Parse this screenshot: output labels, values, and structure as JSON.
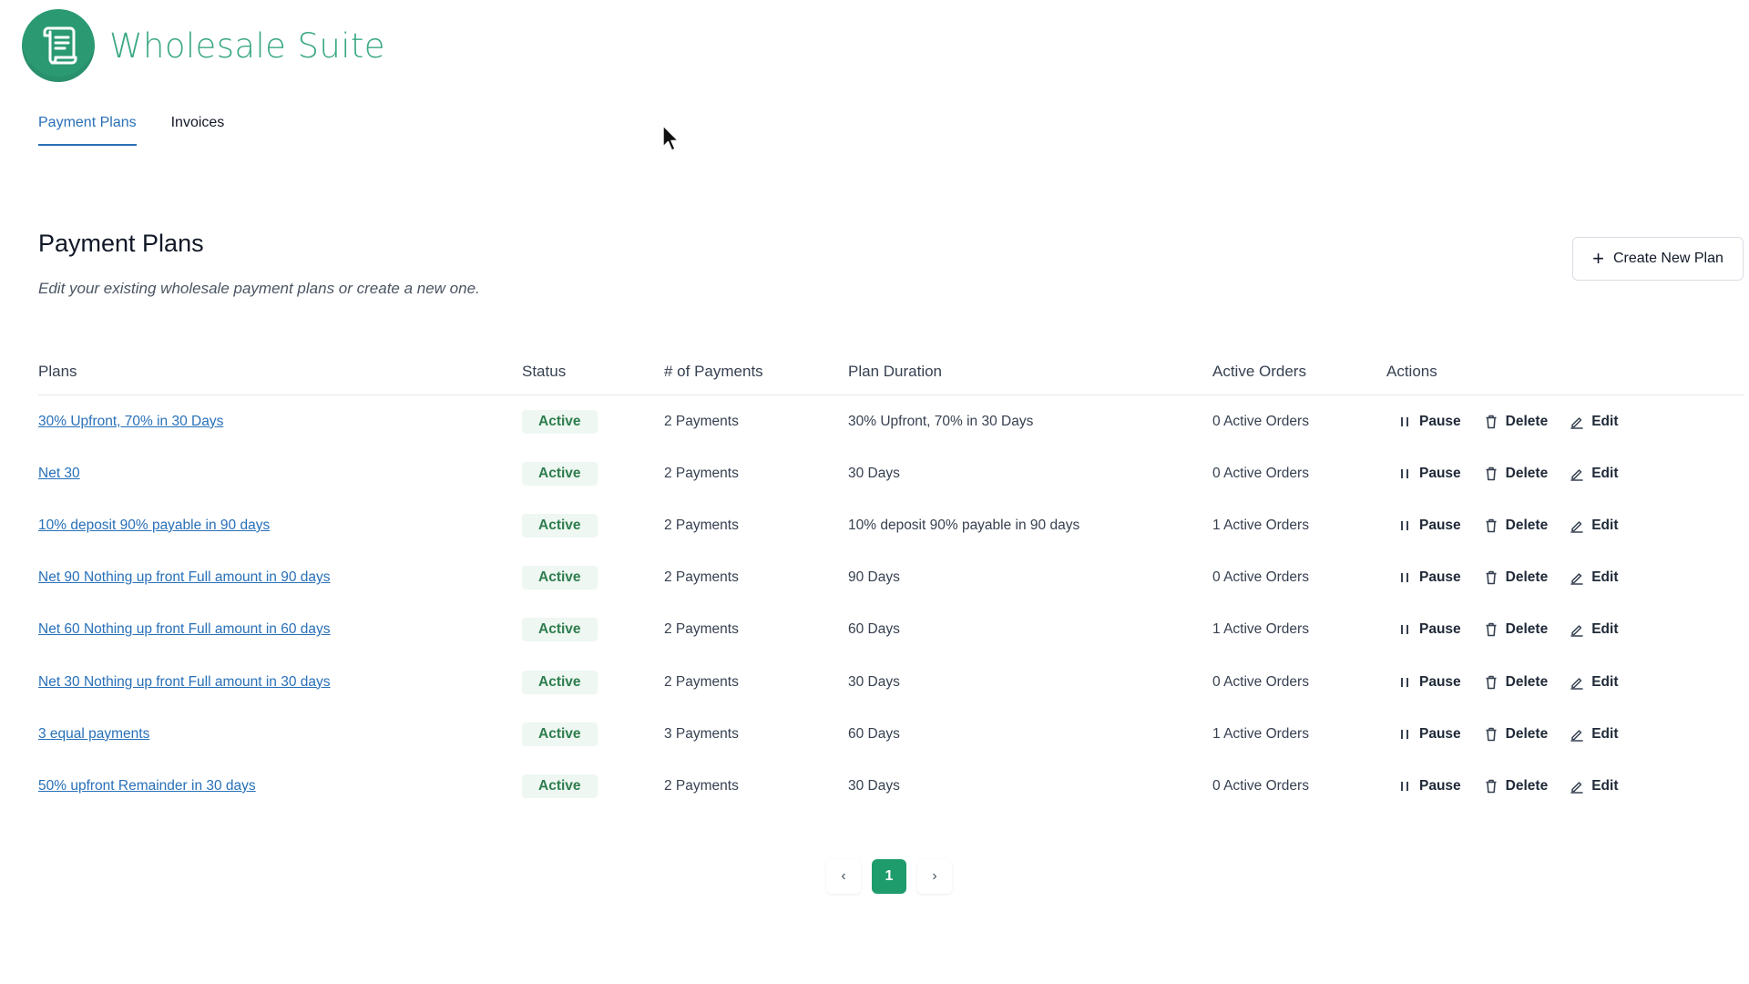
{
  "brand": {
    "name": "Wholesale Suite",
    "logo_icon": "scroll-document-icon",
    "color": "#2b9a73"
  },
  "tabs": [
    {
      "label": "Payment Plans",
      "active": true
    },
    {
      "label": "Invoices",
      "active": false
    }
  ],
  "header": {
    "title": "Payment Plans",
    "subtitle": "Edit your existing wholesale payment plans or create a new one.",
    "create_button": "Create New Plan"
  },
  "table": {
    "columns": [
      "Plans",
      "Status",
      "# of Payments",
      "Plan Duration",
      "Active Orders",
      "Actions"
    ],
    "actions": {
      "pause": "Pause",
      "delete": "Delete",
      "edit": "Edit"
    },
    "rows": [
      {
        "plan": "30% Upfront, 70% in 30 Days",
        "status": "Active",
        "payments": "2 Payments",
        "duration": "30% Upfront, 70% in 30 Days",
        "orders": "0 Active Orders"
      },
      {
        "plan": "Net 30",
        "status": "Active",
        "payments": "2 Payments",
        "duration": "30 Days",
        "orders": "0 Active Orders"
      },
      {
        "plan": "10% deposit 90% payable in 90 days",
        "status": "Active",
        "payments": "2 Payments",
        "duration": "10% deposit 90% payable in 90 days",
        "orders": "1 Active Orders"
      },
      {
        "plan": "Net 90 Nothing up front Full amount in 90 days",
        "status": "Active",
        "payments": "2 Payments",
        "duration": "90 Days",
        "orders": "0 Active Orders"
      },
      {
        "plan": "Net 60 Nothing up front Full amount in 60 days",
        "status": "Active",
        "payments": "2 Payments",
        "duration": "60 Days",
        "orders": "1 Active Orders"
      },
      {
        "plan": "Net 30 Nothing up front Full amount in 30 days",
        "status": "Active",
        "payments": "2 Payments",
        "duration": "30 Days",
        "orders": "0 Active Orders"
      },
      {
        "plan": "3 equal payments",
        "status": "Active",
        "payments": "3 Payments",
        "duration": "60 Days",
        "orders": "1 Active Orders"
      },
      {
        "plan": "50% upfront Remainder in 30 days",
        "status": "Active",
        "payments": "2 Payments",
        "duration": "30 Days",
        "orders": "0 Active Orders"
      }
    ]
  },
  "pagination": {
    "prev": "‹",
    "current": "1",
    "next": "›"
  },
  "colors": {
    "accent": "#1f9c6b",
    "link": "#2870b8",
    "badge_bg": "#eef7f1",
    "badge_text": "#2e7d4f"
  }
}
